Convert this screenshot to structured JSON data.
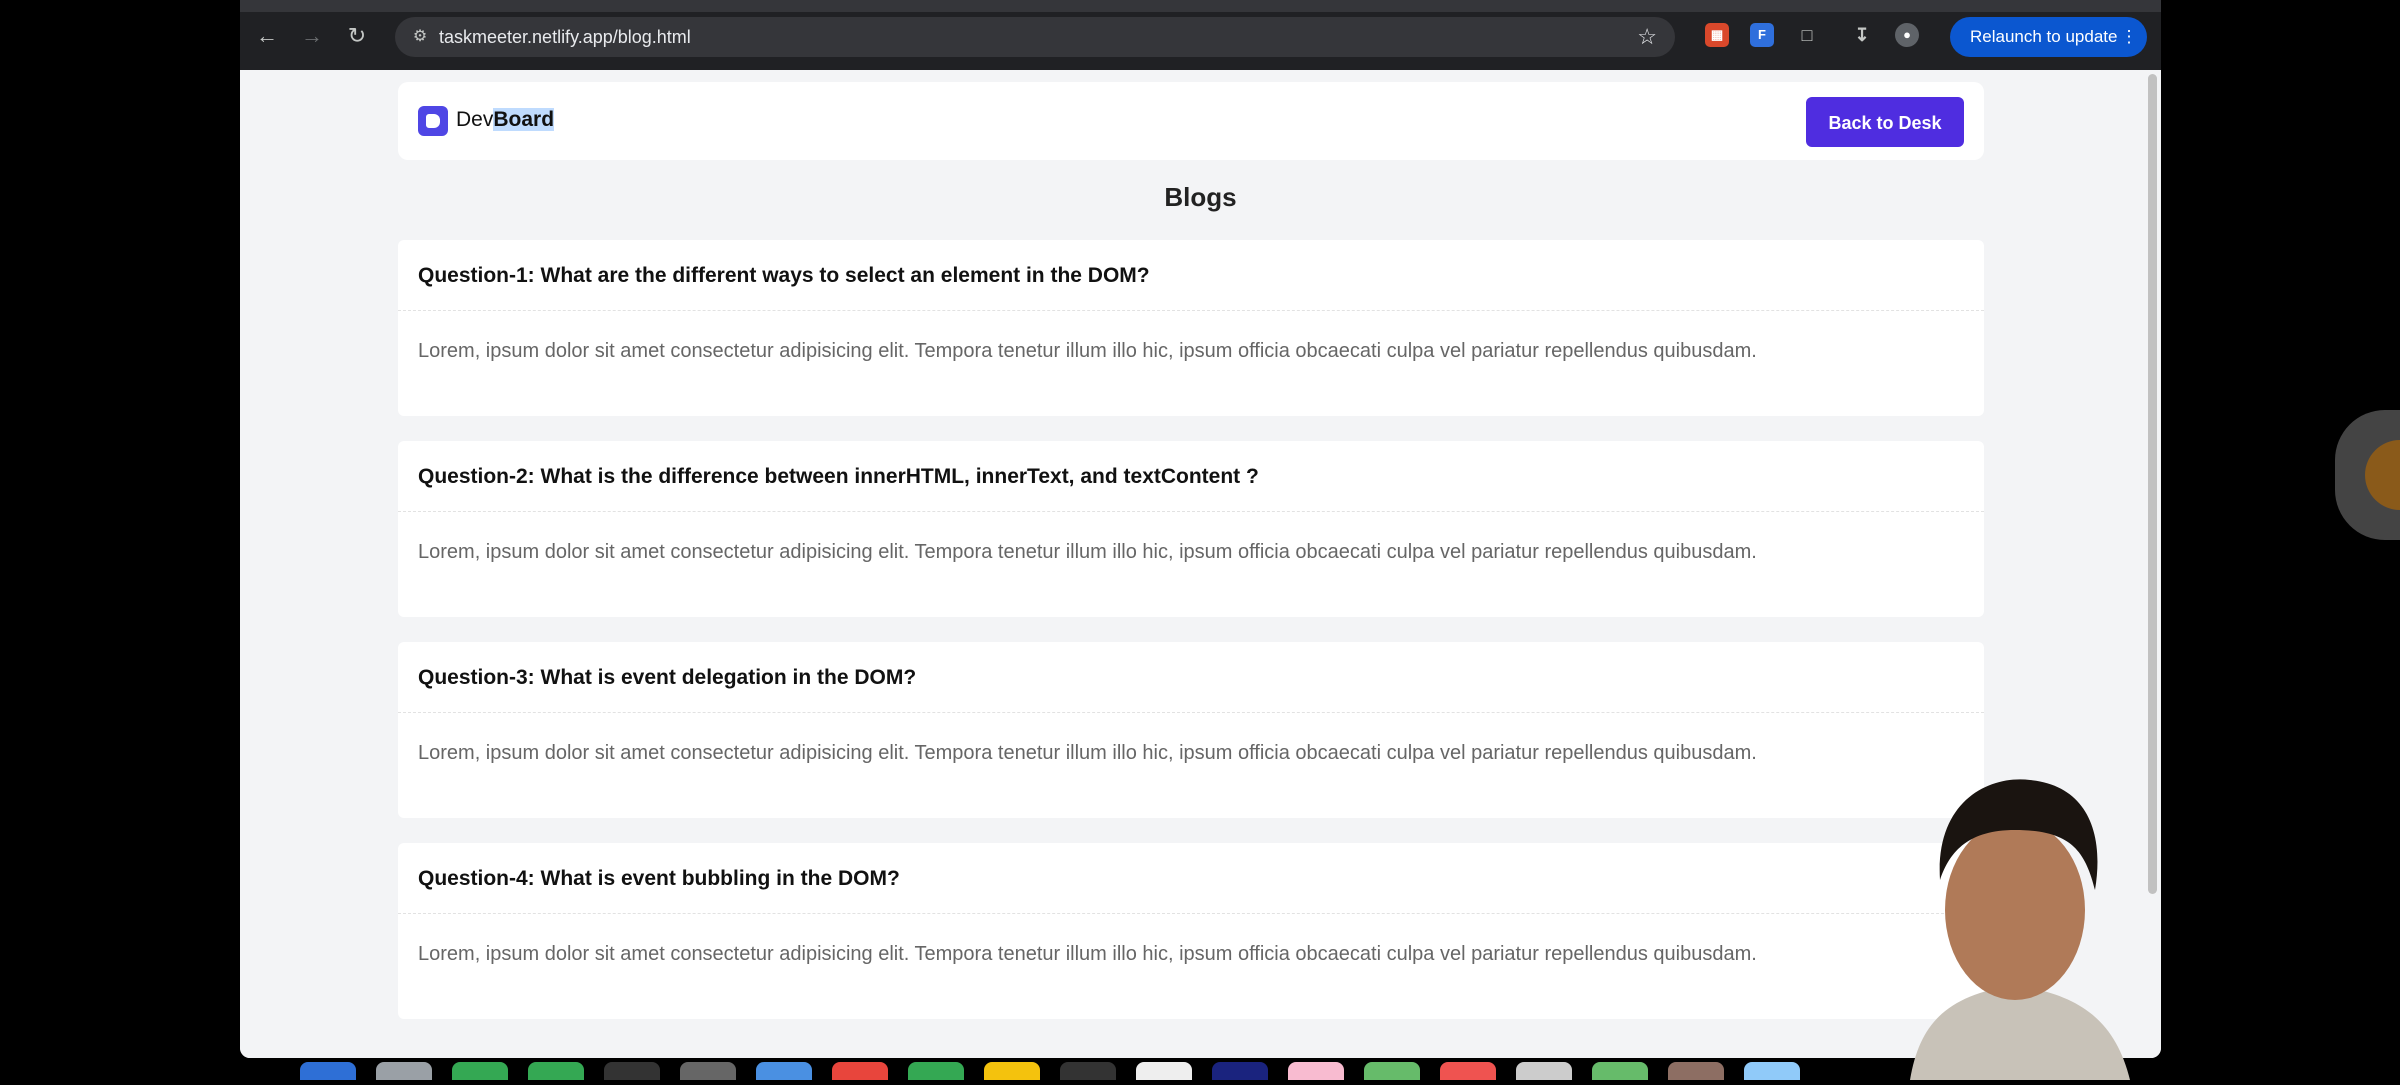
{
  "browser": {
    "url": "taskmeeter.netlify.app/blog.html",
    "relaunch_label": "Relaunch to update",
    "icons": [
      "back-arrow-icon",
      "forward-arrow-icon",
      "reload-icon",
      "site-info-icon",
      "star-icon",
      "extension-icon",
      "download-icon",
      "profile-icon",
      "more-menu-icon"
    ]
  },
  "header": {
    "brand_part1": "Dev",
    "brand_part2": "Board",
    "back_button_label": "Back to Desk"
  },
  "page_title": "Blogs",
  "blogs": [
    {
      "question": "Question-1: What are the different ways to select an element in the DOM?",
      "answer": "Lorem, ipsum dolor sit amet consectetur adipisicing elit. Tempora tenetur illum illo hic, ipsum officia obcaecati culpa vel pariatur repellendus quibusdam."
    },
    {
      "question": "Question-2: What is the difference between innerHTML, innerText, and textContent ?",
      "answer": "Lorem, ipsum dolor sit amet consectetur adipisicing elit. Tempora tenetur illum illo hic, ipsum officia obcaecati culpa vel pariatur repellendus quibusdam."
    },
    {
      "question": "Question-3: What is event delegation in the DOM?",
      "answer": "Lorem, ipsum dolor sit amet consectetur adipisicing elit. Tempora tenetur illum illo hic, ipsum officia obcaecati culpa vel pariatur repellendus quibusdam."
    },
    {
      "question": "Question-4: What is event bubbling in the DOM?",
      "answer": "Lorem, ipsum dolor sit amet consectetur adipisicing elit. Tempora tenetur illum illo hic, ipsum officia obcaecati culpa vel pariatur repellendus quibusdam."
    }
  ],
  "colors": {
    "accent": "#4f2de0",
    "logo": "#4f46e5",
    "page_bg": "#f3f4f6",
    "chrome_bg": "#202124",
    "relaunch_bg": "#0b57d0"
  }
}
